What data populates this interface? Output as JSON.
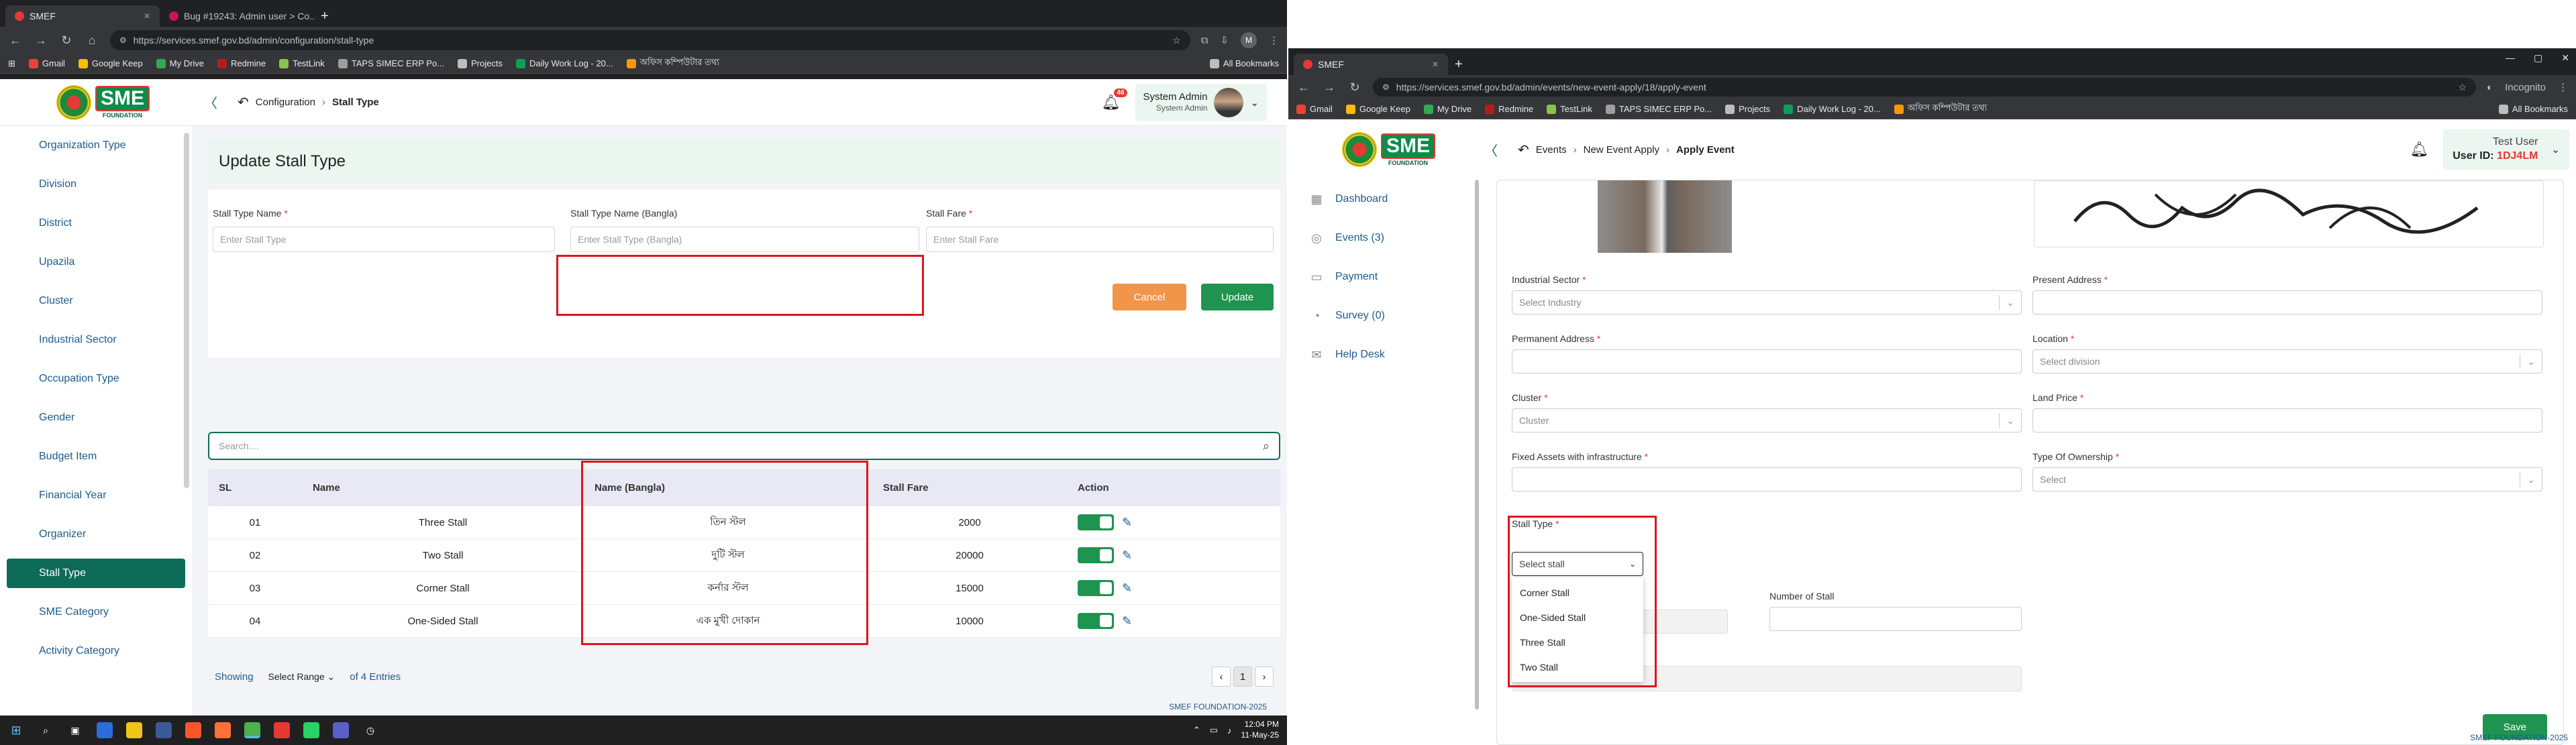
{
  "left": {
    "tabs": [
      {
        "label": "SMEF"
      },
      {
        "label": "Bug #19243: Admin user > Co..."
      }
    ],
    "url": "https://services.smef.gov.bd/admin/configuration/stall-type",
    "profile_initial": "M",
    "bookmarks": [
      "Gmail",
      "Google Keep",
      "My Drive",
      "Redmine",
      "TestLink",
      "TAPS SIMEC ERP Po...",
      "Projects",
      "Daily Work Log - 20...",
      "অফিস কম্পিউটার তথ্য"
    ],
    "all_bookmarks": "All Bookmarks",
    "logo": {
      "sme": "SME",
      "foundation": "FOUNDATION"
    },
    "breadcrumb": {
      "parent": "Configuration",
      "current": "Stall Type"
    },
    "notification_count": "46",
    "user": {
      "name": "System Admin",
      "role": "System Admin"
    },
    "sidebar": [
      "Organization Type",
      "Division",
      "District",
      "Upazila",
      "Cluster",
      "Industrial Sector",
      "Occupation Type",
      "Gender",
      "Budget Item",
      "Financial Year",
      "Organizer",
      "Stall Type",
      "SME Category",
      "Activity Category"
    ],
    "form": {
      "title": "Update Stall Type",
      "name_label": "Stall Type Name",
      "name_placeholder": "Enter Stall Type",
      "bangla_label": "Stall Type Name (Bangla)",
      "bangla_placeholder": "Enter Stall Type (Bangla)",
      "fare_label": "Stall Fare",
      "fare_placeholder": "Enter Stall Fare",
      "cancel": "Cancel",
      "update": "Update"
    },
    "search_placeholder": "Search....",
    "table": {
      "headers": [
        "SL",
        "Name",
        "Name (Bangla)",
        "Stall Fare",
        "Action"
      ],
      "rows": [
        {
          "sl": "01",
          "name": "Three Stall",
          "bangla": "তিন স্টল",
          "fare": "2000"
        },
        {
          "sl": "02",
          "name": "Two Stall",
          "bangla": "দুটি স্টল",
          "fare": "20000"
        },
        {
          "sl": "03",
          "name": "Corner Stall",
          "bangla": "কর্নার স্টল",
          "fare": "15000"
        },
        {
          "sl": "04",
          "name": "One-Sided Stall",
          "bangla": "এক মুখী দোকান",
          "fare": "10000"
        }
      ]
    },
    "pager": {
      "showing": "Showing",
      "range": "Select Range",
      "entries": "of 4 Entries",
      "page": "1"
    },
    "footer": "SMEF FOUNDATION-2025",
    "taskbar": {
      "time": "12:04 PM",
      "date": "11-May-25"
    }
  },
  "right": {
    "tab": "SMEF",
    "url": "https://services.smef.gov.bd/admin/events/new-event-apply/18/apply-event",
    "incognito": "Incognito",
    "bookmarks": [
      "Gmail",
      "Google Keep",
      "My Drive",
      "Redmine",
      "TestLink",
      "TAPS SIMEC ERP Po...",
      "Projects",
      "Daily Work Log - 20...",
      "অফিস কম্পিউটার তথ্য"
    ],
    "all_bookmarks": "All Bookmarks",
    "breadcrumb": {
      "a": "Events",
      "b": "New Event Apply",
      "current": "Apply Event"
    },
    "user": {
      "name": "Test User",
      "id_label": "User ID:",
      "id": "1DJ4LM"
    },
    "sidebar": [
      "Dashboard",
      "Events (3)",
      "Payment",
      "Survey (0)",
      "Help Desk"
    ],
    "fields": {
      "industrial_sector": "Industrial Sector",
      "industry_placeholder": "Select Industry",
      "present_address": "Present Address",
      "permanent_address": "Permanent Address",
      "location": "Location",
      "location_placeholder": "Select division",
      "cluster": "Cluster",
      "cluster_placeholder": "Cluster",
      "land_price": "Land Price",
      "fixed_assets": "Fixed Assets with infrastructure",
      "ownership": "Type Of Ownership",
      "ownership_placeholder": "Select",
      "stall_type": "Stall Type",
      "stall_placeholder": "Select stall",
      "number_of_stall": "Number of Stall"
    },
    "stall_options": [
      "Corner Stall",
      "One-Sided Stall",
      "Three Stall",
      "Two Stall"
    ],
    "save": "Save",
    "footer": "SMEF FOUNDATION-2025"
  },
  "colors": {
    "brand_green": "#0d6b58",
    "button_green": "#1e9450",
    "cancel_orange": "#f0954a",
    "highlight_red": "#e0141e"
  }
}
